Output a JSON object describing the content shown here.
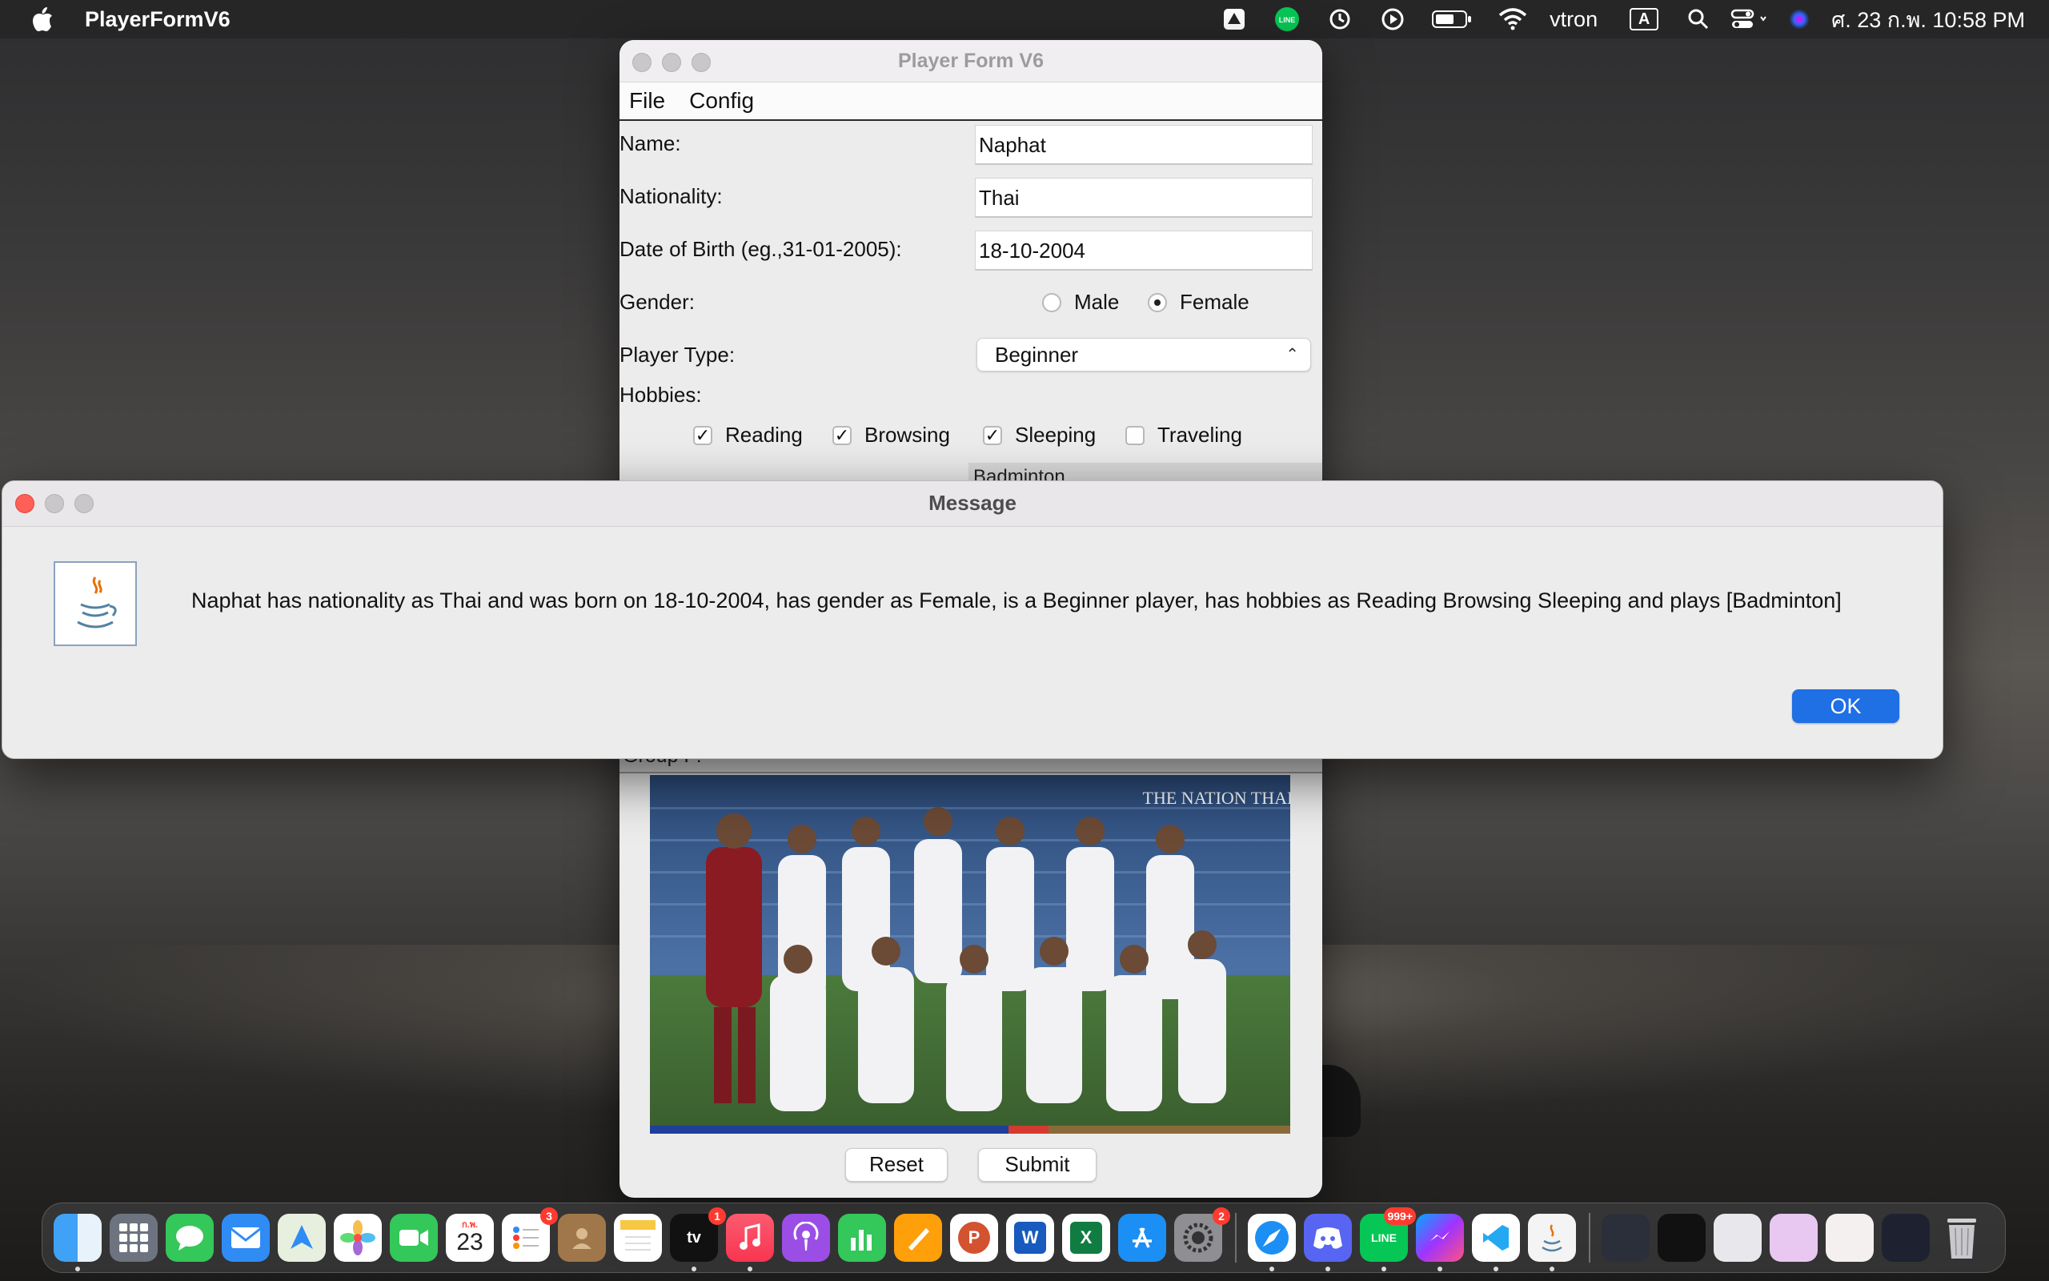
{
  "menubar": {
    "app_name": "PlayerFormV6",
    "user": "vtron",
    "input_source": "A",
    "datetime": "ศ. 23 ก.พ.  10:58 PM",
    "line_label": "LINE"
  },
  "player_form": {
    "title": "Player Form V6",
    "menus": [
      "File",
      "Config"
    ],
    "name_label": "Name:",
    "name_value": "Naphat",
    "nationality_label": "Nationality:",
    "nationality_value": "Thai",
    "dob_label": "Date of Birth (eg.,31-01-2005):",
    "dob_value": "18-10-2004",
    "gender_label": "Gender:",
    "gender_options": [
      "Male",
      "Female"
    ],
    "gender_selected": "Female",
    "player_type_label": "Player Type:",
    "player_type_value": "Beginner",
    "hobbies_label": "Hobbies:",
    "hobbies": [
      {
        "label": "Reading",
        "checked": true
      },
      {
        "label": "Browsing",
        "checked": true
      },
      {
        "label": "Sleeping",
        "checked": true
      },
      {
        "label": "Traveling",
        "checked": false
      }
    ],
    "sport_list_item": "Badminton",
    "group_label": "Group F:",
    "photo_watermark": "THE NATION THAILAND",
    "reset_label": "Reset",
    "submit_label": "Submit"
  },
  "dialog": {
    "title": "Message",
    "message": "Naphat has nationality as Thai and was born on 18-10-2004, has gender as Female, is a Beginner player, has hobbies as Reading Browsing Sleeping and plays [Badminton]",
    "ok_label": "OK"
  },
  "dock": {
    "calendar_day": "23",
    "calendar_month": "ก.พ.",
    "badges": {
      "reminders": "3",
      "tv": "1",
      "settings": "2",
      "line": "999+"
    }
  },
  "colors": {
    "accent": "#1f6fe5",
    "close_red": "#fe5f57",
    "badge_red": "#ff3b30"
  }
}
